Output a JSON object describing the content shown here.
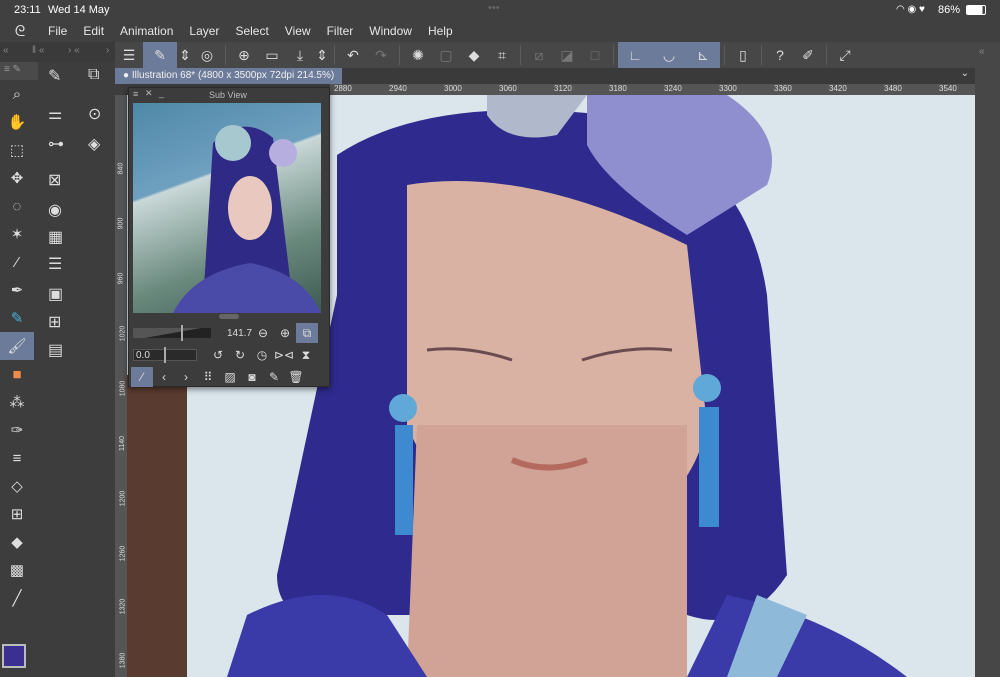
{
  "status": {
    "time": "23:11",
    "date": "Wed 14 May",
    "battery": "86%"
  },
  "menu": [
    "File",
    "Edit",
    "Animation",
    "Layer",
    "Select",
    "View",
    "Filter",
    "Window",
    "Help"
  ],
  "tab": {
    "title": "Illustration 68* (4800 x 3500px 72dpi 214.5%)"
  },
  "ruler": {
    "horizontal": [
      "2880",
      "2940",
      "3000",
      "3060",
      "3120",
      "3180",
      "3240",
      "3300",
      "3360",
      "3420",
      "3480",
      "3540"
    ],
    "vertical": [
      "840",
      "900",
      "960",
      "1020",
      "1080",
      "1140",
      "1200",
      "1260",
      "1320",
      "1380"
    ]
  },
  "subview": {
    "title": "Sub View",
    "zoom": "141.7",
    "rotation": "0.0"
  },
  "colors": {
    "main": "#3b2f8f",
    "accent": "#6d7b9a"
  }
}
